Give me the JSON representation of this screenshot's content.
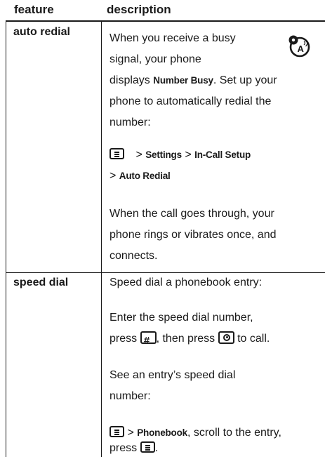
{
  "table": {
    "header": {
      "feature": "feature",
      "description": "description"
    },
    "rows": [
      {
        "feature": "auto redial",
        "icon": "network-dependent-feature-icon",
        "lines": [
          "When you receive a busy",
          "signal, your phone",
          "displays",
          "Number Busy",
          ". Set up your",
          "phone to automatically redial the",
          "number:"
        ],
        "path": {
          "sep": ">",
          "settings": "Settings",
          "setup": "In-Call Setup",
          "redial": "Auto Redial"
        },
        "after": [
          "When the call goes through, your",
          "phone rings or vibrates once, and",
          "connects."
        ]
      },
      {
        "feature": "speed dial",
        "lines": [
          "Speed dial a phonebook entry:",
          "Enter the speed dial number,",
          "press",
          ", then press",
          "to call.",
          "See an entry’s speed dial",
          "number:"
        ],
        "phonebook": "Phonebook",
        "scroll_text": ", scroll to the entry,",
        "press": "press",
        "period": "."
      }
    ]
  }
}
